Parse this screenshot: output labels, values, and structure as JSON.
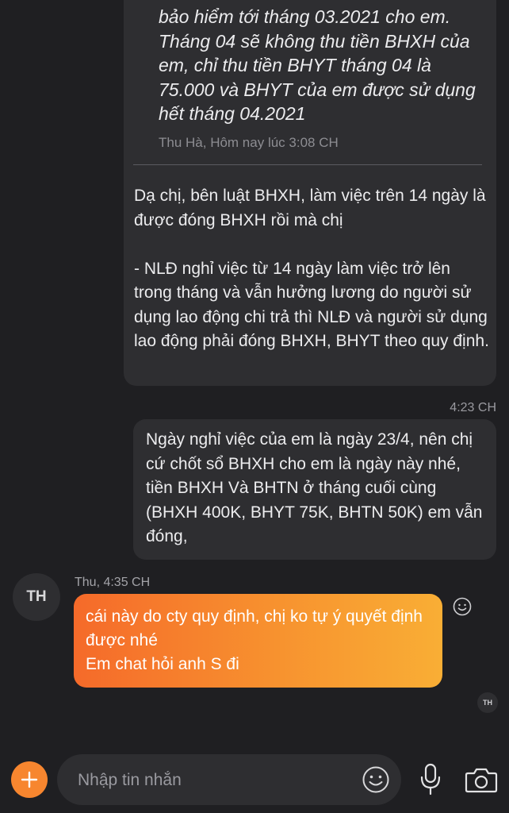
{
  "thread": {
    "quoted_message": {
      "text": "bảo hiểm tới tháng 03.2021 cho em.\nTháng 04 sẽ không thu tiền BHXH của em, chỉ thu tiền BHYT tháng 04 là 75.000 và BHYT của em được sử dụng hết tháng 04.2021",
      "meta": "Thu Hà, Hôm nay lúc 3:08 CH"
    },
    "reply_text": "Dạ chị, bên luật BHXH, làm việc trên 14 ngày là được đóng BHXH rồi mà chị\n\n- NLĐ nghỉ việc từ 14 ngày làm việc trở lên trong tháng và vẫn hưởng lương do người sử dụng lao động chi trả thì NLĐ và người sử dụng lao động phải đóng BHXH, BHYT theo quy định.",
    "outgoing_time": "4:23 CH",
    "outgoing_text": "Ngày nghỉ việc của em là ngày 23/4, nên chị cứ chốt sổ BHXH cho em là ngày này nhé, tiền  BHXH Và BHTN ở tháng cuối cùng (BHXH 400K, BHYT 75K, BHTN 50K) em vẫn đóng,",
    "incoming": {
      "avatar_initials": "TH",
      "meta": "Thu, 4:35 CH",
      "text": "cái này do cty quy định, chị ko tự ý quyết định được nhé\nEm chat hỏi anh S đi"
    },
    "seen_initials": "TH"
  },
  "composer": {
    "placeholder": "Nhập tin nhắn"
  },
  "icons": {
    "plus": "plus-icon",
    "emoji": "emoji-icon",
    "mic": "microphone-icon",
    "camera": "camera-icon",
    "react": "reaction-smiley-icon"
  },
  "colors": {
    "background": "#1f1f22",
    "bubble": "#2e2e31",
    "accent_start": "#f56a2a",
    "accent_end": "#f9ae35",
    "plus_button": "#f7862f"
  }
}
